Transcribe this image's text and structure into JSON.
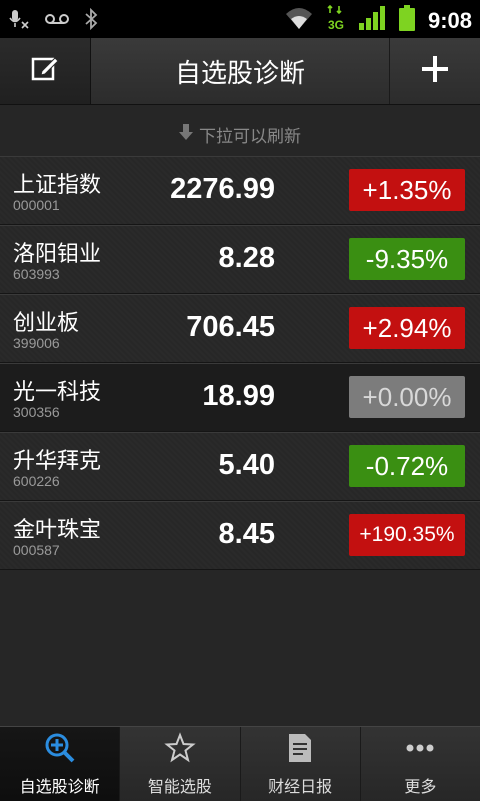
{
  "status_bar": {
    "time": "9:08",
    "icons": [
      "microphone-muted-icon",
      "voicemail-icon",
      "bluetooth-icon",
      "wifi-icon",
      "3g-data-icon",
      "signal-icon",
      "battery-icon"
    ],
    "network_label": "3G"
  },
  "header": {
    "title": "自选股诊断",
    "left_icon": "edit-icon",
    "right_icon": "plus-icon"
  },
  "pull_hint": "下拉可以刷新",
  "stocks": [
    {
      "name": "上证指数",
      "code": "000001",
      "price": "2276.99",
      "change": "+1.35%",
      "direction": "up"
    },
    {
      "name": "洛阳钼业",
      "code": "603993",
      "price": "8.28",
      "change": "-9.35%",
      "direction": "down"
    },
    {
      "name": "创业板",
      "code": "399006",
      "price": "706.45",
      "change": "+2.94%",
      "direction": "up"
    },
    {
      "name": "光一科技",
      "code": "300356",
      "price": "18.99",
      "change": "+0.00%",
      "direction": "flat"
    },
    {
      "name": "升华拜克",
      "code": "600226",
      "price": "5.40",
      "change": "-0.72%",
      "direction": "down"
    },
    {
      "name": "金叶珠宝",
      "code": "000587",
      "price": "8.45",
      "change": "+190.35%",
      "direction": "up"
    }
  ],
  "bottom_nav": [
    {
      "label": "自选股诊断",
      "icon": "search-chart-icon",
      "active": true
    },
    {
      "label": "智能选股",
      "icon": "star-icon",
      "active": false
    },
    {
      "label": "财经日报",
      "icon": "document-icon",
      "active": false
    },
    {
      "label": "更多",
      "icon": "more-icon",
      "active": false
    }
  ],
  "colors": {
    "up": "#c31010",
    "down": "#3a8f12",
    "flat": "#7c7c7c",
    "accent": "#2b8de0"
  }
}
